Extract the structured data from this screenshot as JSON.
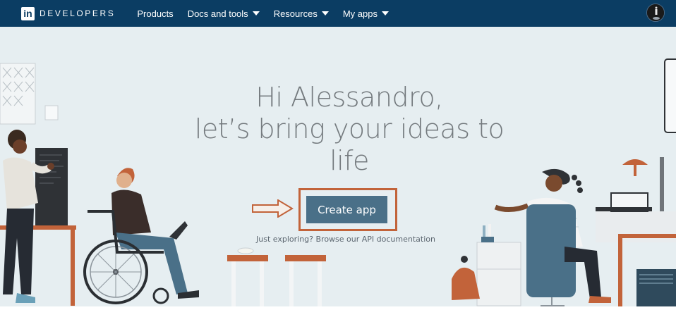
{
  "nav": {
    "logo_text": "in",
    "brand": "DEVELOPERS",
    "links": [
      {
        "label": "Products"
      },
      {
        "label": "Docs and tools"
      },
      {
        "label": "Resources"
      },
      {
        "label": "My apps"
      }
    ]
  },
  "hero": {
    "greeting_line1": "Hi Alessandro,",
    "greeting_line2": "let’s bring your ideas to",
    "greeting_line3": "life",
    "cta_label": "Create app",
    "explore_text": "Just exploring? Browse our API documentation"
  },
  "colors": {
    "nav_bg": "#0b3d63",
    "hero_bg": "#e6eef1",
    "cta_bg": "#4a7088",
    "annotation": "#c2633a"
  }
}
